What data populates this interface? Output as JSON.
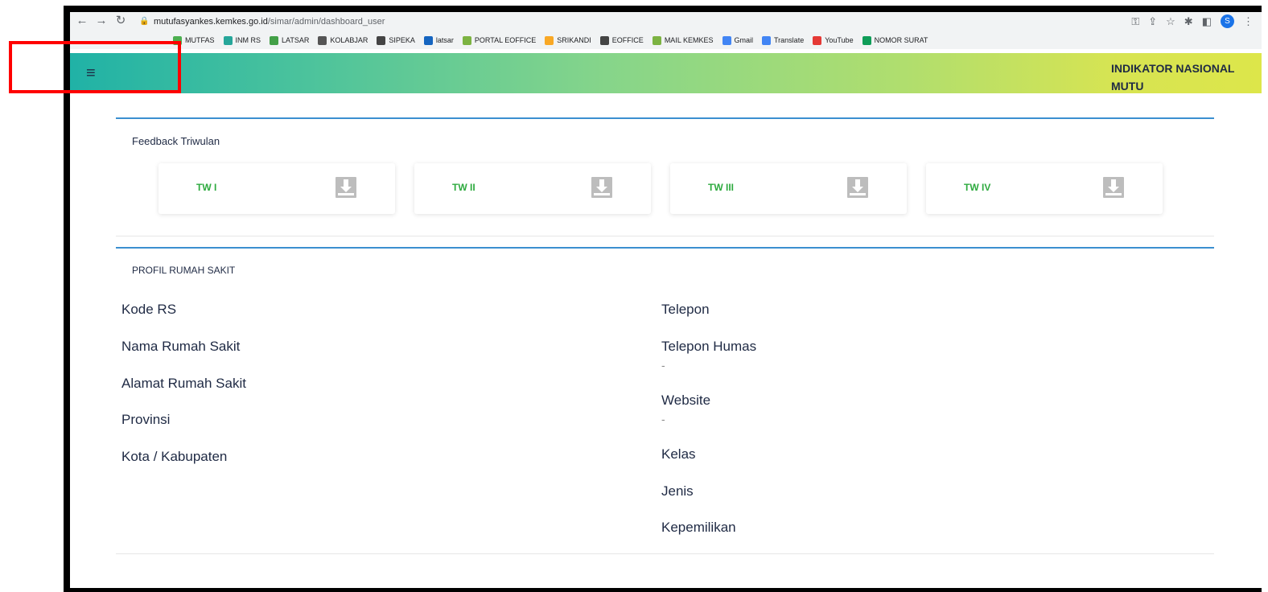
{
  "browser": {
    "url_host": "mutufasyankes.kemkes.go.id",
    "url_path": "/simar/admin/dashboard_user",
    "back_icon": "arrow-left-icon",
    "forward_icon": "arrow-right-icon",
    "reload_icon": "reload-icon",
    "profile_initial": "S"
  },
  "bookmarks": [
    {
      "label": "MUTFAS",
      "color": "#4caf50"
    },
    {
      "label": "INM RS",
      "color": "#26a69a"
    },
    {
      "label": "LATSAR",
      "color": "#43a047"
    },
    {
      "label": "KOLABJAR",
      "color": "#555555"
    },
    {
      "label": "SIPEKA",
      "color": "#444444"
    },
    {
      "label": "latsar",
      "color": "#1565c0"
    },
    {
      "label": "PORTAL EOFFICE",
      "color": "#7cb342"
    },
    {
      "label": "SRIKANDI",
      "color": "#f9a825"
    },
    {
      "label": "EOFFICE",
      "color": "#444444"
    },
    {
      "label": "MAIL KEMKES",
      "color": "#7cb342"
    },
    {
      "label": "Gmail",
      "color": "#4285f4"
    },
    {
      "label": "Translate",
      "color": "#4285f4"
    },
    {
      "label": "YouTube",
      "color": "#e53935"
    },
    {
      "label": "NOMOR SURAT",
      "color": "#0f9d58"
    }
  ],
  "header": {
    "menu_icon": "hamburger-icon",
    "brand_line1": "INDIKATOR NASIONAL",
    "brand_line2": "MUTU"
  },
  "feedback": {
    "title": "Feedback Triwulan",
    "items": [
      {
        "label": "TW I"
      },
      {
        "label": "TW II"
      },
      {
        "label": "TW III"
      },
      {
        "label": "TW IV"
      }
    ]
  },
  "profil": {
    "title": "PROFIL RUMAH SAKIT",
    "left": [
      {
        "label": "Kode RS"
      },
      {
        "label": "Nama Rumah Sakit"
      },
      {
        "label": "Alamat Rumah Sakit"
      },
      {
        "label": "Provinsi"
      },
      {
        "label": "Kota / Kabupaten"
      }
    ],
    "right": [
      {
        "label": "Telepon",
        "value": ""
      },
      {
        "label": "Telepon Humas",
        "value": "-"
      },
      {
        "label": "Website",
        "value": "-"
      },
      {
        "label": "Kelas",
        "value": ""
      },
      {
        "label": "Jenis",
        "value": ""
      },
      {
        "label": "Kepemilikan",
        "value": ""
      }
    ]
  },
  "colors": {
    "accent_line": "#3b8fd0",
    "tw_label": "#2eaa3f",
    "highlight": "#ff0000"
  }
}
